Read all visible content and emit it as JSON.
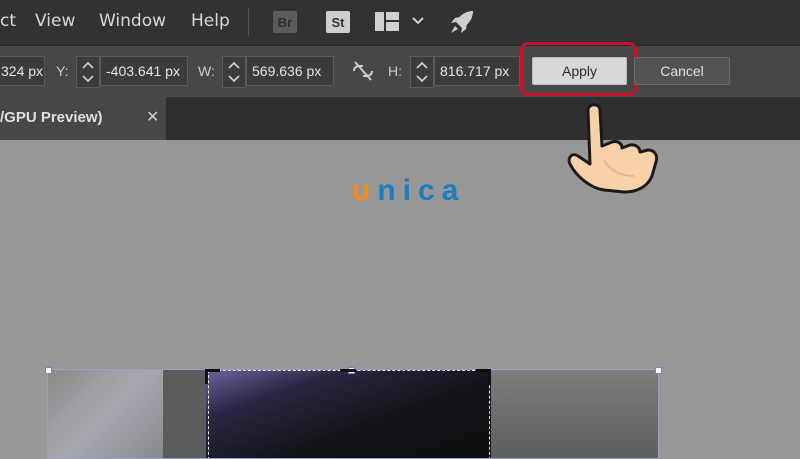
{
  "menubar": {
    "items": [
      "ct",
      "View",
      "Window",
      "Help"
    ],
    "app_icons": [
      "Br",
      "St"
    ]
  },
  "options": {
    "x_value_fragment": "324 px",
    "y_label": "Y:",
    "y_value": "-403.641 px",
    "w_label": "W:",
    "w_value": "569.636 px",
    "h_label": "H:",
    "h_value": "816.717 px",
    "apply_label": "Apply",
    "cancel_label": "Cancel",
    "highlight_color": "#c8102e"
  },
  "tab": {
    "title": "/GPU Preview)",
    "close": "✕"
  },
  "logo": {
    "u": "u",
    "rest": "nica",
    "color_u": "#f28a1e",
    "color_rest": "#1a7ec2"
  }
}
